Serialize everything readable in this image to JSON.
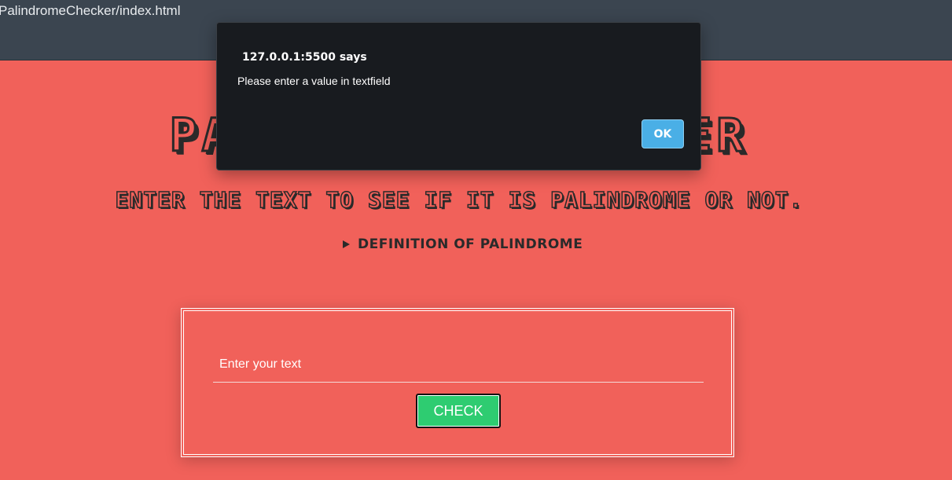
{
  "browser": {
    "url": "PalindromeChecker/index.html"
  },
  "page": {
    "title": "PALINDROME CHECKER",
    "subtitle": "Enter the text to see if it is palindrome or not.",
    "definition_summary": "Definition of Palindrome",
    "input": {
      "placeholder": "Enter your text",
      "value": ""
    },
    "check_label": "CHECK"
  },
  "dialog": {
    "origin": "127.0.0.1:5500 says",
    "message": "Please enter a value in textfield",
    "ok_label": "OK"
  },
  "colors": {
    "page_background": "#f1615a",
    "topbar": "#3b4550",
    "dialog_background": "#181b1f",
    "check_button": "#2ecc71",
    "ok_button": "#4aafe6"
  },
  "icons": {
    "details_marker": "play-triangle-icon"
  }
}
